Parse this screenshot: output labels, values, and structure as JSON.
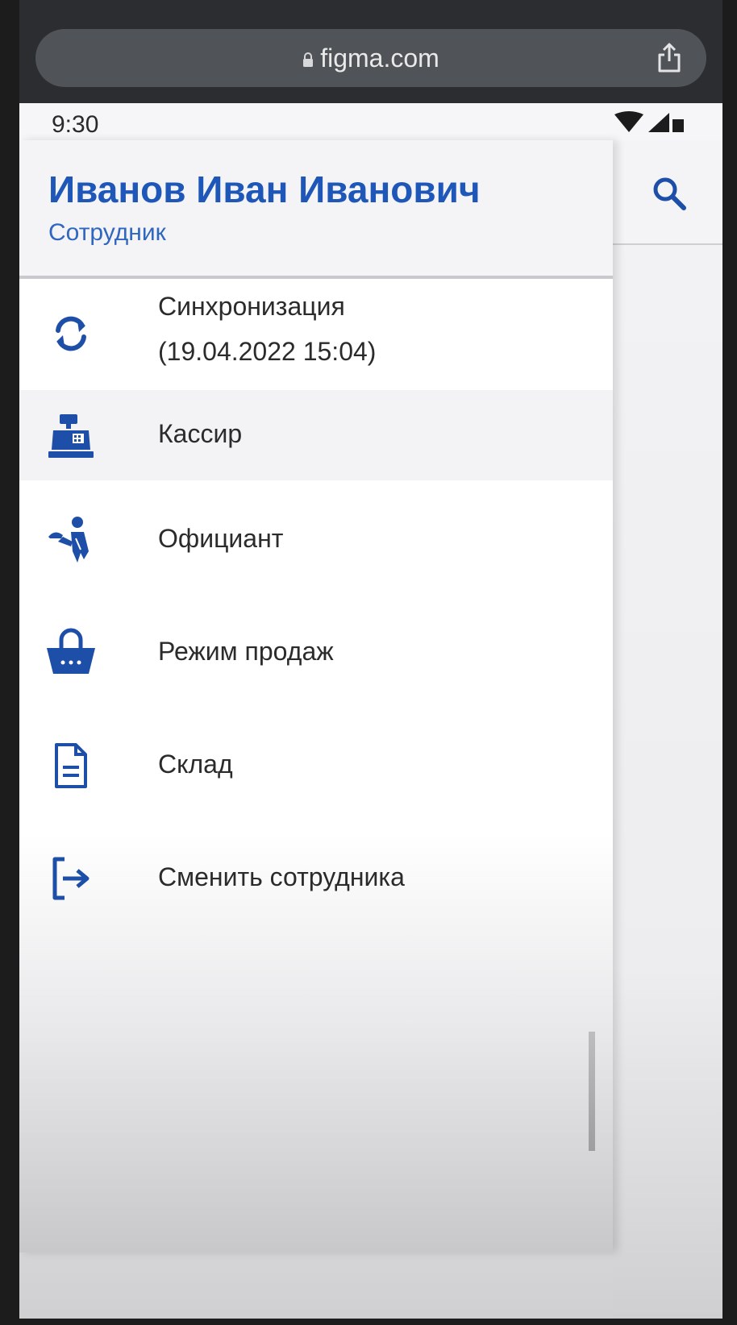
{
  "browser": {
    "url": "figma.com"
  },
  "status_bar": {
    "time": "9:30"
  },
  "drawer": {
    "user_name": "Иванов Иван Иванович",
    "user_role": "Сотрудник",
    "items": [
      {
        "label_line1": "Синхронизация",
        "label_line2": "(19.04.2022 15:04)",
        "icon": "sync-icon"
      },
      {
        "label": "Кассир",
        "icon": "cash-register-icon",
        "active": true
      },
      {
        "label": "Официант",
        "icon": "waiter-icon"
      },
      {
        "label": "Режим продаж",
        "icon": "shopping-basket-icon"
      },
      {
        "label": "Склад",
        "icon": "document-icon"
      },
      {
        "label": "Сменить сотрудника",
        "icon": "logout-icon"
      }
    ]
  },
  "colors": {
    "accent": "#1f57b8",
    "icon": "#1e4fa8",
    "text": "#2b2b2b"
  }
}
